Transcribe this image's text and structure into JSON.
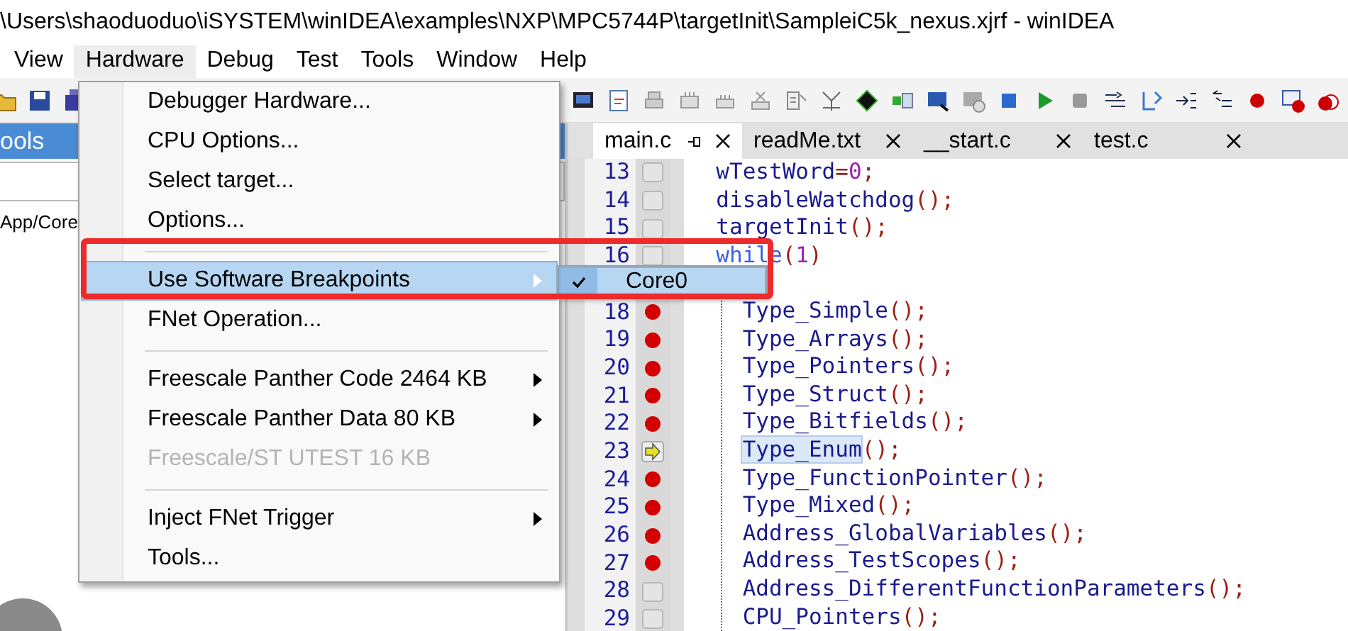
{
  "window": {
    "title": "\\Users\\shaoduoduo\\iSYSTEM\\winIDEA\\examples\\NXP\\MPC5744P\\targetInit\\SampleiC5k_nexus.xjrf - winIDEA"
  },
  "menu_bar": [
    {
      "label": "View",
      "selected": false
    },
    {
      "label": "Hardware",
      "selected": true
    },
    {
      "label": "Debug",
      "selected": false
    },
    {
      "label": "Test",
      "selected": false
    },
    {
      "label": "Tools",
      "selected": false
    },
    {
      "label": "Window",
      "selected": false
    },
    {
      "label": "Help",
      "selected": false
    }
  ],
  "left_panel": {
    "header": "ools",
    "path": "App/Core"
  },
  "hardware_menu": [
    {
      "kind": "item",
      "label": "Debugger Hardware...",
      "selected": false,
      "disabled": false,
      "submenu": false
    },
    {
      "kind": "item",
      "label": "CPU Options...",
      "selected": false,
      "disabled": false,
      "submenu": false
    },
    {
      "kind": "item",
      "label": "Select target...",
      "selected": false,
      "disabled": false,
      "submenu": false
    },
    {
      "kind": "item",
      "label": "Options...",
      "selected": false,
      "disabled": false,
      "submenu": false
    },
    {
      "kind": "separator"
    },
    {
      "kind": "item",
      "label": "Use Software Breakpoints",
      "selected": true,
      "disabled": false,
      "submenu": true
    },
    {
      "kind": "item",
      "label": "FNet Operation...",
      "selected": false,
      "disabled": false,
      "submenu": false
    },
    {
      "kind": "separator"
    },
    {
      "kind": "item",
      "label": "Freescale Panther Code 2464 KB",
      "selected": false,
      "disabled": false,
      "submenu": true
    },
    {
      "kind": "item",
      "label": "Freescale Panther Data 80 KB",
      "selected": false,
      "disabled": false,
      "submenu": true
    },
    {
      "kind": "item",
      "label": "Freescale/ST UTEST 16 KB",
      "selected": false,
      "disabled": true,
      "submenu": false
    },
    {
      "kind": "separator"
    },
    {
      "kind": "item",
      "label": "Inject FNet Trigger",
      "selected": false,
      "disabled": false,
      "submenu": true
    },
    {
      "kind": "item",
      "label": "Tools...",
      "selected": false,
      "disabled": false,
      "submenu": false
    }
  ],
  "submenu": [
    {
      "label": "Core0",
      "checked": true,
      "selected": true
    }
  ],
  "editor_tabs": [
    {
      "label": "main.c",
      "selected": true,
      "pinned": true
    },
    {
      "label": "readMe.txt",
      "selected": false,
      "pinned": false
    },
    {
      "label": "__start.c",
      "selected": false,
      "pinned": false
    },
    {
      "label": "test.c",
      "selected": false,
      "pinned": false
    }
  ],
  "code_lines": [
    {
      "kind": "line",
      "number": "13",
      "breakpoint": false,
      "current": false,
      "tokens": [
        {
          "kind": "ident",
          "text": "wTestWord"
        },
        {
          "kind": "punct",
          "text": "="
        },
        {
          "kind": "number",
          "text": "0"
        },
        {
          "kind": "punct",
          "text": ";"
        }
      ]
    },
    {
      "kind": "line",
      "number": "14",
      "breakpoint": false,
      "current": false,
      "tokens": [
        {
          "kind": "ident",
          "text": "disableWatchdog"
        },
        {
          "kind": "punct",
          "text": "();"
        }
      ]
    },
    {
      "kind": "line",
      "number": "15",
      "breakpoint": false,
      "current": false,
      "tokens": [
        {
          "kind": "ident",
          "text": "targetInit"
        },
        {
          "kind": "punct",
          "text": "();"
        }
      ]
    },
    {
      "kind": "line",
      "number": "16",
      "breakpoint": false,
      "current": false,
      "tokens": [
        {
          "kind": "keyword",
          "text": "while"
        },
        {
          "kind": "punct",
          "text": "("
        },
        {
          "kind": "number",
          "text": "1"
        },
        {
          "kind": "punct",
          "text": ")"
        }
      ],
      "children": [
        {
          "kind": "hidden"
        },
        {
          "kind": "line",
          "number": "18",
          "breakpoint": true,
          "current": false,
          "tokens": [
            {
              "kind": "ident",
              "text": "Type_Simple"
            },
            {
              "kind": "punct",
              "text": "();"
            }
          ]
        },
        {
          "kind": "line",
          "number": "19",
          "breakpoint": true,
          "current": false,
          "tokens": [
            {
              "kind": "ident",
              "text": "Type_Arrays"
            },
            {
              "kind": "punct",
              "text": "();"
            }
          ]
        },
        {
          "kind": "line",
          "number": "20",
          "breakpoint": true,
          "current": false,
          "tokens": [
            {
              "kind": "ident",
              "text": "Type_Pointers"
            },
            {
              "kind": "punct",
              "text": "();"
            }
          ]
        },
        {
          "kind": "line",
          "number": "21",
          "breakpoint": true,
          "current": false,
          "tokens": [
            {
              "kind": "ident",
              "text": "Type_Struct"
            },
            {
              "kind": "punct",
              "text": "();"
            }
          ]
        },
        {
          "kind": "line",
          "number": "22",
          "breakpoint": true,
          "current": false,
          "tokens": [
            {
              "kind": "ident",
              "text": "Type_Bitfields"
            },
            {
              "kind": "punct",
              "text": "();"
            }
          ]
        },
        {
          "kind": "line",
          "number": "23",
          "breakpoint": false,
          "current": true,
          "tokens": [
            {
              "kind": "match",
              "text": "Type_Enum"
            },
            {
              "kind": "punct",
              "text": "();"
            }
          ]
        },
        {
          "kind": "line",
          "number": "24",
          "breakpoint": true,
          "current": false,
          "tokens": [
            {
              "kind": "ident",
              "text": "Type_FunctionPointer"
            },
            {
              "kind": "punct",
              "text": "();"
            }
          ]
        },
        {
          "kind": "line",
          "number": "25",
          "breakpoint": true,
          "current": false,
          "tokens": [
            {
              "kind": "ident",
              "text": "Type_Mixed"
            },
            {
              "kind": "punct",
              "text": "();"
            }
          ]
        },
        {
          "kind": "line",
          "number": "26",
          "breakpoint": true,
          "current": false,
          "tokens": [
            {
              "kind": "ident",
              "text": "Address_GlobalVariables"
            },
            {
              "kind": "punct",
              "text": "();"
            }
          ]
        },
        {
          "kind": "line",
          "number": "27",
          "breakpoint": true,
          "current": false,
          "tokens": [
            {
              "kind": "ident",
              "text": "Address_TestScopes"
            },
            {
              "kind": "punct",
              "text": "();"
            }
          ]
        },
        {
          "kind": "line",
          "number": "28",
          "breakpoint": false,
          "current": false,
          "tokens": [
            {
              "kind": "ident",
              "text": "Address_DifferentFunctionParameters"
            },
            {
              "kind": "punct",
              "text": "();"
            }
          ]
        },
        {
          "kind": "line",
          "number": "29",
          "breakpoint": false,
          "current": false,
          "tokens": [
            {
              "kind": "ident",
              "text": "CPU_Pointers"
            },
            {
              "kind": "punct",
              "text": "();"
            }
          ]
        }
      ]
    }
  ]
}
